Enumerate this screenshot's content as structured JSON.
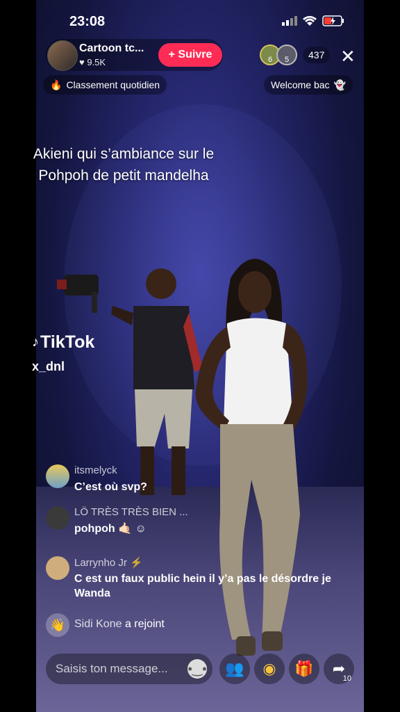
{
  "status_bar": {
    "time": "23:08"
  },
  "header": {
    "host_name": "Cartoon tc...",
    "likes": "9.5K",
    "follow_label": "+ Suivre",
    "viewer_count": "437",
    "viewer_badges": [
      "6",
      "5"
    ],
    "close_symbol": "✕"
  },
  "pills": {
    "ranking": "Classement quotidien",
    "welcome": "Welcome bac"
  },
  "caption": "Akieni qui s’ambiance sur le Pohpoh de petit mandelha",
  "watermark": {
    "brand": "TikTok",
    "username": "x_dnl"
  },
  "comments": [
    {
      "user": "itsmelyck",
      "text": "C’est où svp?"
    },
    {
      "user": "LÖ TRÈS TRÈS BIEN ...",
      "text": "pohpoh 🤙🏻 ☺"
    },
    {
      "user": "Larrynho Jr ⚡",
      "text": "C est un faux public hein il y’a pas le désordre je Wanda"
    }
  ],
  "join": {
    "user": "Sidi Kone",
    "action": "a rejoint"
  },
  "input": {
    "placeholder": "Saisis ton message..."
  },
  "actions": {
    "share_count": "10"
  },
  "colors": {
    "accent": "#fe2c55",
    "background": "#1b1d55"
  },
  "icons": [
    "signal-icon",
    "wifi-icon",
    "battery-icon",
    "heart-icon",
    "close-icon",
    "fire-icon",
    "ghost-icon",
    "wave-icon",
    "emoji-icon",
    "guest-icon",
    "tiktok-coin-icon",
    "gift-icon",
    "share-icon"
  ]
}
